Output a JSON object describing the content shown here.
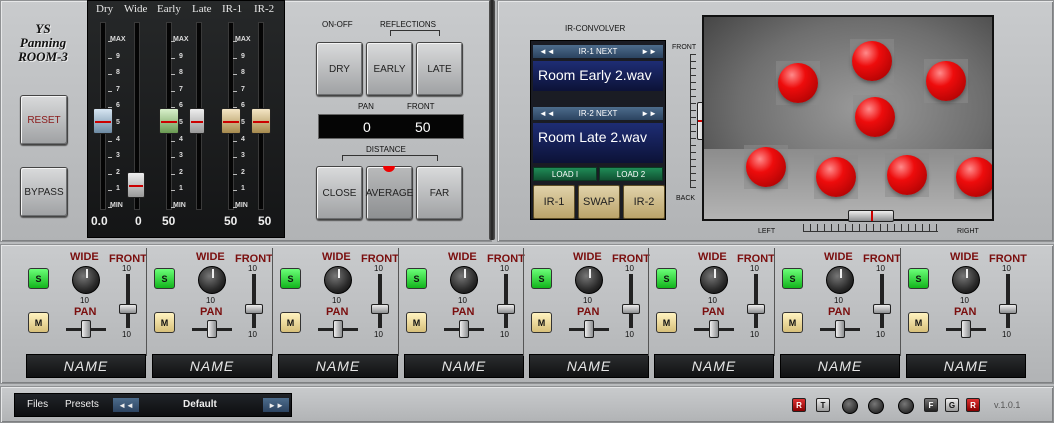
{
  "app": {
    "title": "YS Panning ROOM-3",
    "version": "v.1.0.1"
  },
  "left": {
    "reset": "RESET",
    "bypass": "BYPASS"
  },
  "faders": {
    "headers": [
      "Dry",
      "Wide",
      "Early",
      "Late",
      "IR-1",
      "IR-2"
    ],
    "scale": [
      "MAX",
      "9",
      "8",
      "7",
      "6",
      "5",
      "4",
      "3",
      "2",
      "1",
      "MIN"
    ],
    "values": [
      "0.0",
      "0",
      "50",
      "50",
      "50"
    ]
  },
  "reflections": {
    "on_off_label": "ON-OFF",
    "reflections_label": "REFLECTIONS",
    "buttons": [
      "DRY",
      "EARLY",
      "LATE"
    ],
    "pan_label": "PAN",
    "front_label": "FRONT",
    "pan_value": "0",
    "front_value": "50",
    "distance_label": "DISTANCE",
    "distance_buttons": [
      "CLOSE",
      "AVERAGE",
      "FAR"
    ]
  },
  "ir": {
    "title": "IR-CONVOLVER",
    "nav1": "IR-1 NEXT",
    "file1": "Room Early 2.wav",
    "nav2": "IR-2 NEXT",
    "file2": "Room Late 2.wav",
    "load1": "LOAD I",
    "load2": "LOAD 2",
    "sel": [
      "IR-1",
      "SWAP",
      "IR-2"
    ]
  },
  "room": {
    "front": "FRONT",
    "back": "BACK",
    "left": "LEFT",
    "right": "RIGHT"
  },
  "strips": [
    {
      "s": "S",
      "m": "M",
      "wide": "WIDE",
      "front": "FRONT",
      "front_val": "10",
      "wide_val": "10",
      "pan": "PAN",
      "pan_val": "10",
      "name": "NAME"
    },
    {
      "s": "S",
      "m": "M",
      "wide": "WIDE",
      "front": "FRONT",
      "front_val": "10",
      "wide_val": "10",
      "pan": "PAN",
      "pan_val": "10",
      "name": "NAME"
    },
    {
      "s": "S",
      "m": "M",
      "wide": "WIDE",
      "front": "FRONT",
      "front_val": "10",
      "wide_val": "10",
      "pan": "PAN",
      "pan_val": "10",
      "name": "NAME"
    },
    {
      "s": "S",
      "m": "M",
      "wide": "WIDE",
      "front": "FRONT",
      "front_val": "10",
      "wide_val": "10",
      "pan": "PAN",
      "pan_val": "10",
      "name": "NAME"
    },
    {
      "s": "S",
      "m": "M",
      "wide": "WIDE",
      "front": "FRONT",
      "front_val": "10",
      "wide_val": "10",
      "pan": "PAN",
      "pan_val": "10",
      "name": "NAME"
    },
    {
      "s": "S",
      "m": "M",
      "wide": "WIDE",
      "front": "FRONT",
      "front_val": "10",
      "wide_val": "10",
      "pan": "PAN",
      "pan_val": "10",
      "name": "NAME"
    },
    {
      "s": "S",
      "m": "M",
      "wide": "WIDE",
      "front": "FRONT",
      "front_val": "10",
      "wide_val": "10",
      "pan": "PAN",
      "pan_val": "10",
      "name": "NAME"
    },
    {
      "s": "S",
      "m": "M",
      "wide": "WIDE",
      "front": "FRONT",
      "front_val": "10",
      "wide_val": "10",
      "pan": "PAN",
      "pan_val": "10",
      "name": "NAME"
    }
  ],
  "bottom": {
    "files": "Files",
    "presets": "Presets",
    "preset_name": "Default",
    "prev": "◄◄",
    "next": "►►"
  },
  "tools": {
    "r1": "R",
    "t": "T",
    "f": "F",
    "g": "G",
    "r2": "R"
  },
  "colors": {
    "solo_green": "#12b41c",
    "ball_red": "#ee0c0c",
    "accent_red": "#c00000",
    "lcd_blue": "#1e2d74"
  }
}
